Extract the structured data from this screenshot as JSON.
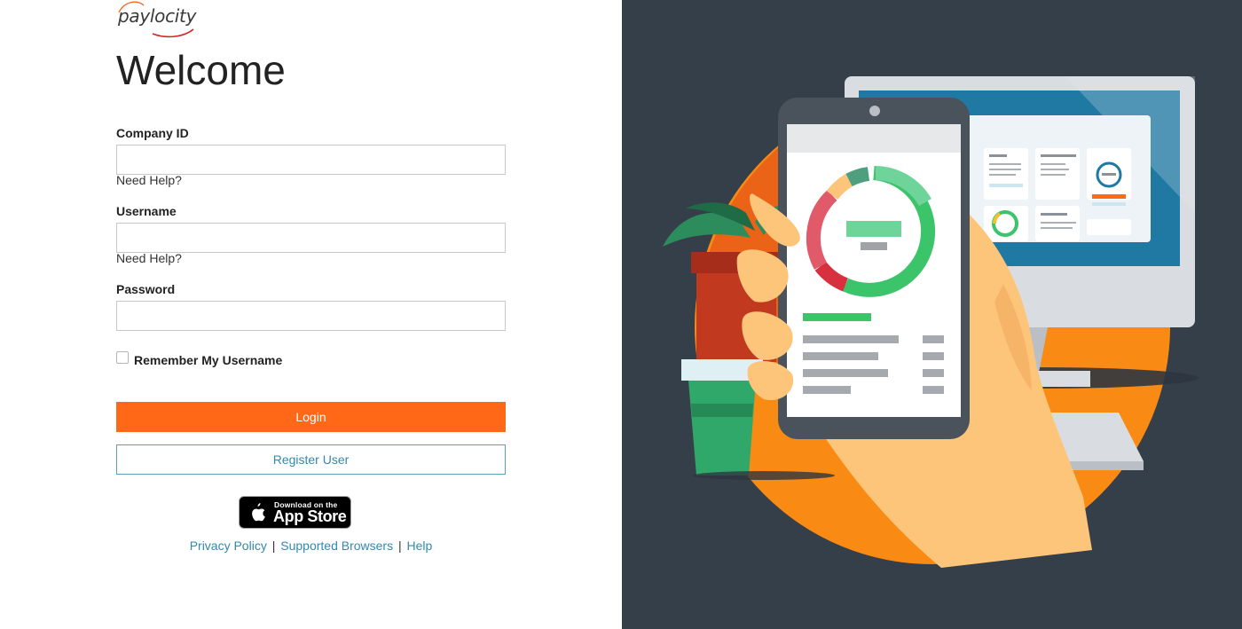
{
  "brand": {
    "logo_text": "paylocity",
    "accent_color": "#fe6816",
    "link_color": "#3389ae"
  },
  "form": {
    "heading": "Welcome",
    "company_id": {
      "label": "Company ID",
      "value": "",
      "help": "Need Help?"
    },
    "username": {
      "label": "Username",
      "value": "",
      "help": "Need Help?"
    },
    "password": {
      "label": "Password",
      "value": ""
    },
    "remember": {
      "label": "Remember My Username",
      "checked": false
    },
    "login_label": "Login",
    "register_label": "Register User"
  },
  "app_store": {
    "line1": "Download on the",
    "line2": "App Store",
    "icon": "apple-icon"
  },
  "footer": {
    "links": [
      {
        "label": "Privacy Policy"
      },
      {
        "label": "Supported Browsers"
      },
      {
        "label": "Help"
      }
    ],
    "separator": "|"
  },
  "illustration": {
    "background_color": "#353f4a",
    "description_icon": "phone-dashboard-illustration"
  }
}
